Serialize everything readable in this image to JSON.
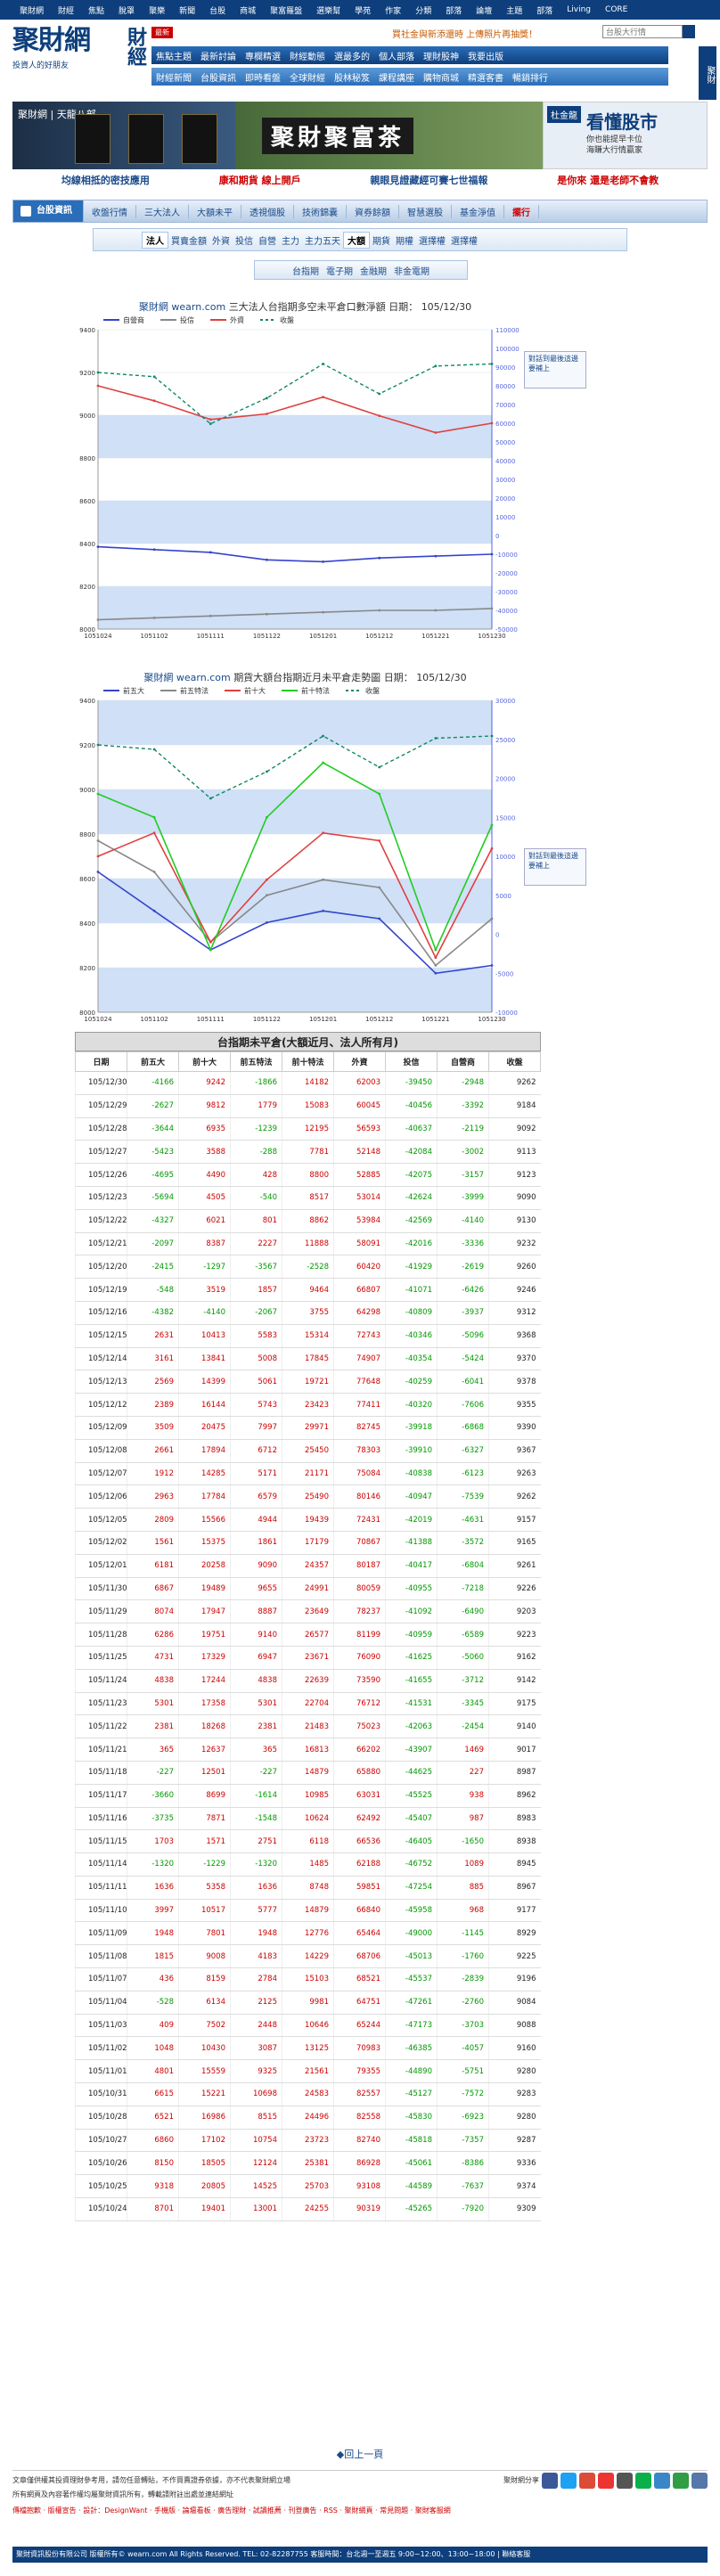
{
  "topbar": [
    "聚財網",
    "財經",
    "焦點",
    "脫罩",
    "聚樂",
    "新聞",
    "台股",
    "商城",
    "聚富羅盤",
    "選樂幫",
    "學苑",
    "作家",
    "分類",
    "部落",
    "論壇",
    "主題",
    "部落",
    "Living",
    "CORE"
  ],
  "header": {
    "logo_main": "聚財網",
    "logo_cal": "財經",
    "logo_sub": "投資人的好朋友",
    "new_badge": "最新",
    "ticker": "買社金與新添還時 上傳照片再抽獎！",
    "search_placeholder": "台股大行情",
    "side_tab": "聚財",
    "nav1": [
      "焦點主題",
      "最新討論",
      "專欄精選",
      "財經動態",
      "選最多的",
      "個人部落",
      "理財股神",
      "我要出版"
    ],
    "nav2": [
      "財經新聞",
      "台股資訊",
      "即時看盤",
      "全球財經",
      "股林秘笈",
      "課程講座",
      "購物商城",
      "精選客書",
      "暢銷排行"
    ]
  },
  "banner": {
    "left_title": "聚財網 | 天龍八部",
    "mid_title": "聚財聚富茶",
    "right_tag": "杜金龍",
    "right_title": "看懂股市",
    "right_sub": "你也能提早卡位\n海賺大行情贏家"
  },
  "promo": [
    {
      "text": "均線相抵的密技應用",
      "color": "#1a4a8a"
    },
    {
      "text": "康和期貨 線上開戶",
      "color": "#c00"
    },
    {
      "text": "親眼見證藏經可賽七世福報",
      "color": "#1a4a8a"
    },
    {
      "text": "是你來 還是老師不會教",
      "color": "#c00"
    }
  ],
  "mainnav": [
    "台股資訊",
    "收盤行情",
    "三大法人",
    "大額未平",
    "透視個股",
    "技術錦囊",
    "資券餘額",
    "智慧選股",
    "基金淨值",
    "擺行"
  ],
  "subtabs": {
    "label": "法人",
    "items": [
      "買賣金額",
      "外資",
      "投信",
      "自營",
      "主力",
      "主力五天"
    ],
    "sel2": "大額",
    "items2": [
      "期貨",
      "期權",
      "選擇權",
      "選擇權"
    ]
  },
  "subtabs2": [
    "台指期",
    "電子期",
    "金融期",
    "非金電期"
  ],
  "chart1": {
    "title_site": "聚財網",
    "title_url": "wearn.com",
    "title_mid": "三大法人台指期多空未平倉口數淨額",
    "title_date_label": "日期：",
    "title_date": "105/12/30",
    "legend": [
      "自營商",
      "投信",
      "外資",
      "收盤"
    ],
    "side_note": "對話到最後這邊要補上",
    "x_ticks": [
      "1051024",
      "1051102",
      "1051111",
      "1051122",
      "1051201",
      "1051212",
      "1051221",
      "1051230"
    ]
  },
  "chart2": {
    "title_site": "聚財網",
    "title_url": "wearn.com",
    "title_mid": "期貨大額台指期近月未平倉走勢圖",
    "title_date_label": "日期：",
    "title_date": "105/12/30",
    "legend": [
      "前五大",
      "前五特法",
      "前十大",
      "前十特法",
      "收盤"
    ],
    "side_note": "對話到最後這邊要補上",
    "x_ticks": [
      "1051024",
      "1051102",
      "1051111",
      "1051122",
      "1051201",
      "1051212",
      "1051221",
      "1051230"
    ]
  },
  "chart_data": [
    {
      "type": "line",
      "x": [
        "1051024",
        "1051102",
        "1051111",
        "1051122",
        "1051201",
        "1051212",
        "1051221",
        "1051230"
      ],
      "y_left_ticks": [
        9400,
        9200,
        9000,
        8800,
        8600,
        8400,
        8200,
        8000
      ],
      "y_right_ticks": [
        110000,
        100000,
        90000,
        80000,
        70000,
        60000,
        50000,
        40000,
        30000,
        20000,
        10000,
        0,
        -10000,
        -20000,
        -30000,
        -40000,
        -50000
      ],
      "series": [
        {
          "name": "自營商",
          "values": [
            -6000,
            -7500,
            -9000,
            -13000,
            -14000,
            -12000,
            -11000,
            -10000
          ]
        },
        {
          "name": "投信",
          "values": [
            -45000,
            -44000,
            -43000,
            -42000,
            -41000,
            -40000,
            -40000,
            -39000
          ]
        },
        {
          "name": "外資",
          "values": [
            80000,
            72000,
            62000,
            65000,
            74000,
            64000,
            55000,
            60000
          ]
        },
        {
          "name": "收盤",
          "values": [
            9200,
            9180,
            8960,
            9080,
            9240,
            9100,
            9230,
            9240
          ]
        }
      ]
    },
    {
      "type": "line",
      "x": [
        "1051024",
        "1051102",
        "1051111",
        "1051122",
        "1051201",
        "1051212",
        "1051221",
        "1051230"
      ],
      "y_left_ticks": [
        9400,
        9200,
        9000,
        8800,
        8600,
        8400,
        8200,
        8000
      ],
      "y_right_ticks": [
        30000,
        25000,
        20000,
        15000,
        10000,
        5000,
        0,
        -5000,
        -10000
      ],
      "series": [
        {
          "name": "前五大",
          "values": [
            8000,
            3000,
            -2000,
            1500,
            3000,
            2000,
            -5000,
            -4000
          ]
        },
        {
          "name": "前五特法",
          "values": [
            12000,
            8000,
            -1000,
            5000,
            7000,
            6000,
            -4000,
            2000
          ]
        },
        {
          "name": "前十大",
          "values": [
            10000,
            13000,
            -1000,
            7000,
            13000,
            12000,
            -3000,
            11000
          ]
        },
        {
          "name": "前十特法",
          "values": [
            18000,
            15000,
            -2000,
            15000,
            22000,
            18000,
            -2000,
            14000
          ]
        },
        {
          "name": "收盤",
          "values": [
            9200,
            9180,
            8960,
            9080,
            9240,
            9100,
            9230,
            9240
          ]
        }
      ]
    }
  ],
  "table": {
    "title": "台指期未平倉(大額近月、法人所有月)",
    "headers": [
      "日期",
      "前五大",
      "前十大",
      "前五特法",
      "前十特法",
      "外資",
      "投信",
      "自營商",
      "收盤"
    ],
    "rows": [
      [
        "105/12/30",
        "-4166",
        "9242",
        "-1866",
        "14182",
        "62003",
        "-39450",
        "-2948",
        "9262"
      ],
      [
        "105/12/29",
        "-2627",
        "9812",
        "1779",
        "15083",
        "60045",
        "-40456",
        "-3392",
        "9184"
      ],
      [
        "105/12/28",
        "-3644",
        "6935",
        "-1239",
        "12195",
        "56593",
        "-40637",
        "-2119",
        "9092"
      ],
      [
        "105/12/27",
        "-5423",
        "3588",
        "-288",
        "7781",
        "52148",
        "-42084",
        "-3002",
        "9113"
      ],
      [
        "105/12/26",
        "-4695",
        "4490",
        "428",
        "8800",
        "52885",
        "-42075",
        "-3157",
        "9123"
      ],
      [
        "105/12/23",
        "-5694",
        "4505",
        "-540",
        "8517",
        "53014",
        "-42624",
        "-3999",
        "9090"
      ],
      [
        "105/12/22",
        "-4327",
        "6021",
        "801",
        "8862",
        "53984",
        "-42569",
        "-4140",
        "9130"
      ],
      [
        "105/12/21",
        "-2097",
        "8387",
        "2227",
        "11888",
        "58091",
        "-42016",
        "-3336",
        "9232"
      ],
      [
        "105/12/20",
        "-2415",
        "-1297",
        "-3567",
        "-2528",
        "60420",
        "-41929",
        "-2619",
        "9260"
      ],
      [
        "105/12/19",
        "-548",
        "3519",
        "1857",
        "9464",
        "66807",
        "-41071",
        "-6426",
        "9246"
      ],
      [
        "105/12/16",
        "-4382",
        "-4140",
        "-2067",
        "3755",
        "64298",
        "-40809",
        "-3937",
        "9312"
      ],
      [
        "105/12/15",
        "2631",
        "10413",
        "5583",
        "15314",
        "72743",
        "-40346",
        "-5096",
        "9368"
      ],
      [
        "105/12/14",
        "3161",
        "13841",
        "5008",
        "17845",
        "74907",
        "-40354",
        "-5424",
        "9370"
      ],
      [
        "105/12/13",
        "2569",
        "14399",
        "5061",
        "19721",
        "77648",
        "-40259",
        "-6041",
        "9378"
      ],
      [
        "105/12/12",
        "2389",
        "16144",
        "5743",
        "23423",
        "77411",
        "-40320",
        "-7606",
        "9355"
      ],
      [
        "105/12/09",
        "3509",
        "20475",
        "7997",
        "29971",
        "82745",
        "-39918",
        "-6868",
        "9390"
      ],
      [
        "105/12/08",
        "2661",
        "17894",
        "6712",
        "25450",
        "78303",
        "-39910",
        "-6327",
        "9367"
      ],
      [
        "105/12/07",
        "1912",
        "14285",
        "5171",
        "21171",
        "75084",
        "-40838",
        "-6123",
        "9263"
      ],
      [
        "105/12/06",
        "2963",
        "17784",
        "6579",
        "25490",
        "80146",
        "-40947",
        "-7539",
        "9262"
      ],
      [
        "105/12/05",
        "2809",
        "15566",
        "4944",
        "19439",
        "72431",
        "-42019",
        "-4631",
        "9157"
      ],
      [
        "105/12/02",
        "1561",
        "15375",
        "1861",
        "17179",
        "70867",
        "-41388",
        "-3572",
        "9165"
      ],
      [
        "105/12/01",
        "6181",
        "20258",
        "9090",
        "24357",
        "80187",
        "-40417",
        "-6804",
        "9261"
      ],
      [
        "105/11/30",
        "6867",
        "19489",
        "9655",
        "24991",
        "80059",
        "-40955",
        "-7218",
        "9226"
      ],
      [
        "105/11/29",
        "8074",
        "17947",
        "8887",
        "23649",
        "78237",
        "-41092",
        "-6490",
        "9203"
      ],
      [
        "105/11/28",
        "6286",
        "19751",
        "9140",
        "26577",
        "81199",
        "-40959",
        "-6589",
        "9223"
      ],
      [
        "105/11/25",
        "4731",
        "17329",
        "6947",
        "23671",
        "76090",
        "-41625",
        "-5060",
        "9162"
      ],
      [
        "105/11/24",
        "4838",
        "17244",
        "4838",
        "22639",
        "73590",
        "-41655",
        "-3712",
        "9142"
      ],
      [
        "105/11/23",
        "5301",
        "17358",
        "5301",
        "22704",
        "76712",
        "-41531",
        "-3345",
        "9175"
      ],
      [
        "105/11/22",
        "2381",
        "18268",
        "2381",
        "21483",
        "75023",
        "-42063",
        "-2454",
        "9140"
      ],
      [
        "105/11/21",
        "365",
        "12637",
        "365",
        "16813",
        "66202",
        "-43907",
        "1469",
        "9017"
      ],
      [
        "105/11/18",
        "-227",
        "12501",
        "-227",
        "14879",
        "65880",
        "-44625",
        "227",
        "8987"
      ],
      [
        "105/11/17",
        "-3660",
        "8699",
        "-1614",
        "10985",
        "63031",
        "-45525",
        "938",
        "8962"
      ],
      [
        "105/11/16",
        "-3735",
        "7871",
        "-1548",
        "10624",
        "62492",
        "-45407",
        "987",
        "8983"
      ],
      [
        "105/11/15",
        "1703",
        "1571",
        "2751",
        "6118",
        "66536",
        "-46405",
        "-1650",
        "8938"
      ],
      [
        "105/11/14",
        "-1320",
        "-1229",
        "-1320",
        "1485",
        "62188",
        "-46752",
        "1089",
        "8945"
      ],
      [
        "105/11/11",
        "1636",
        "5358",
        "1636",
        "8748",
        "59851",
        "-47254",
        "885",
        "8967"
      ],
      [
        "105/11/10",
        "3997",
        "10517",
        "5777",
        "14879",
        "66840",
        "-45958",
        "968",
        "9177"
      ],
      [
        "105/11/09",
        "1948",
        "7801",
        "1948",
        "12776",
        "65464",
        "-49000",
        "-1145",
        "8929"
      ],
      [
        "105/11/08",
        "1815",
        "9008",
        "4183",
        "14229",
        "68706",
        "-45013",
        "-1760",
        "9225"
      ],
      [
        "105/11/07",
        "436",
        "8159",
        "2784",
        "15103",
        "68521",
        "-45537",
        "-2839",
        "9196"
      ],
      [
        "105/11/04",
        "-528",
        "6134",
        "2125",
        "9981",
        "64751",
        "-47261",
        "-2760",
        "9084"
      ],
      [
        "105/11/03",
        "409",
        "7502",
        "2448",
        "10646",
        "65244",
        "-47173",
        "-3703",
        "9088"
      ],
      [
        "105/11/02",
        "1048",
        "10430",
        "3087",
        "13125",
        "70983",
        "-46385",
        "-4057",
        "9160"
      ],
      [
        "105/11/01",
        "4801",
        "15559",
        "9325",
        "21561",
        "79355",
        "-44890",
        "-5751",
        "9280"
      ],
      [
        "105/10/31",
        "6615",
        "15221",
        "10698",
        "24583",
        "82557",
        "-45127",
        "-7572",
        "9283"
      ],
      [
        "105/10/28",
        "6521",
        "16986",
        "8515",
        "24496",
        "82558",
        "-45830",
        "-6923",
        "9280"
      ],
      [
        "105/10/27",
        "6860",
        "17102",
        "10754",
        "23723",
        "82740",
        "-45818",
        "-7357",
        "9287"
      ],
      [
        "105/10/26",
        "8150",
        "18505",
        "12124",
        "25381",
        "86928",
        "-45061",
        "-8386",
        "9336"
      ],
      [
        "105/10/25",
        "9318",
        "20805",
        "14525",
        "25703",
        "93108",
        "-44589",
        "-7637",
        "9374"
      ],
      [
        "105/10/24",
        "8701",
        "19401",
        "13001",
        "24255",
        "90319",
        "-45265",
        "-7920",
        "9309"
      ]
    ]
  },
  "back_link": "◆回上一頁",
  "footer": {
    "line1": "文章僅供權其投資理財參考用，請勿任意轉貼，不作買賣證券依據，亦不代表聚財網立場",
    "line2": "所有網頁及內容著作權均屬聚財資訊所有，轉載請附註出處並連結網址",
    "sns_label": "聚財網分享",
    "links": "傳檔抱歉 · 版權宣告 · 設計：DesignWant · 手機版 · 論壇看板 · 廣告理財 · 試讀推薦 · 刊登廣告 · RSS · 聚財網頁 · 常見問題 · 聚財客服網",
    "copyright": "聚財資訊股份有限公司 版權所有© wearn.com All Rights Reserved. TEL: 02-82287755 客服時間：台北週一至週五 9:00~12:00、13:00~18:00 | 聯絡客服"
  }
}
